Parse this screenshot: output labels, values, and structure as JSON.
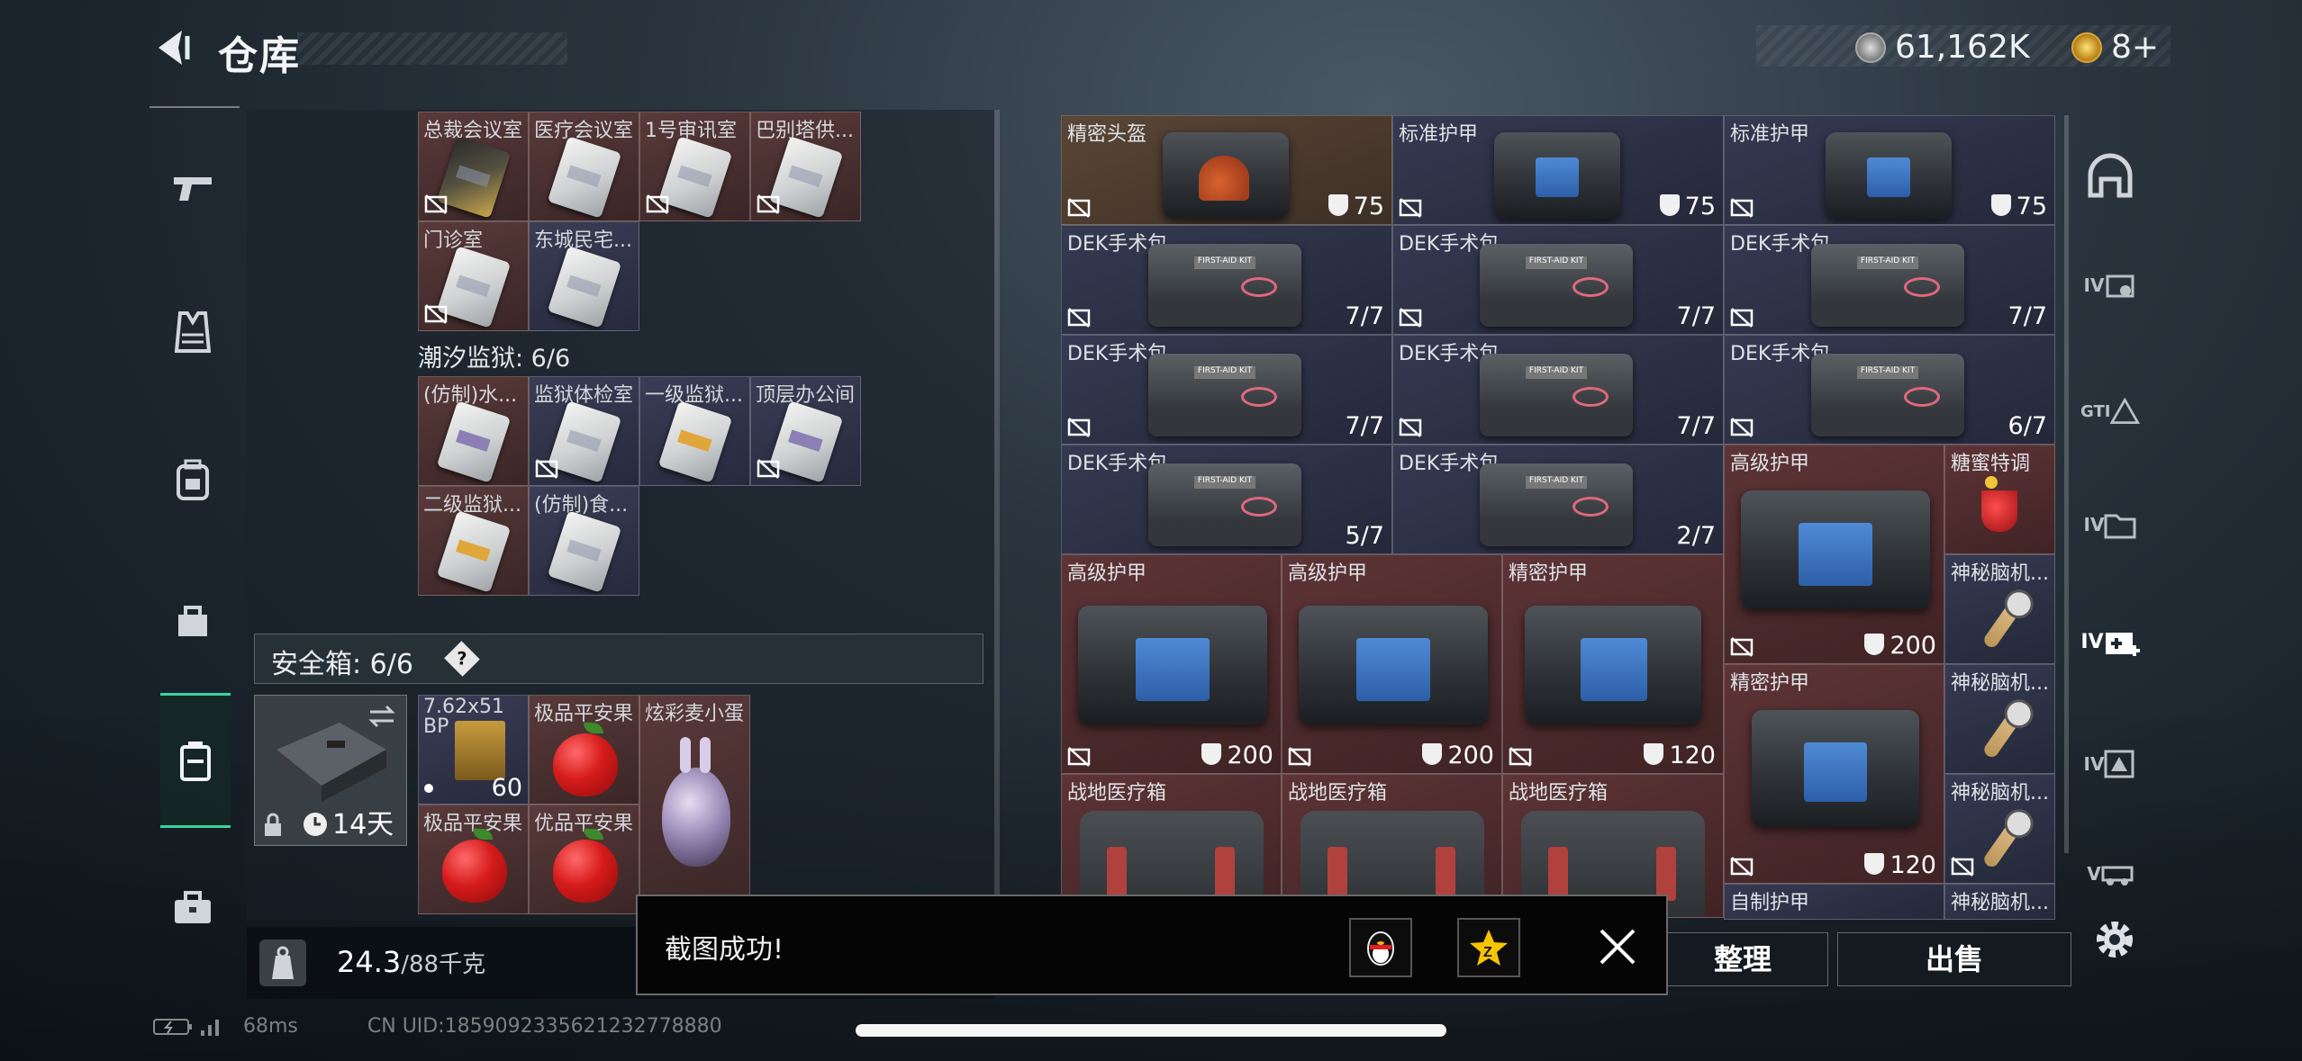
{
  "header": {
    "title": "仓库",
    "currency": [
      {
        "name": "silver-coin-icon",
        "value": "61,162K"
      },
      {
        "name": "gold-coin-icon",
        "value": "8+"
      }
    ]
  },
  "left_sidebar": {
    "items": [
      {
        "name": "weapon-tab",
        "icon": "pistol-icon"
      },
      {
        "name": "armor-tab",
        "icon": "vest-icon"
      },
      {
        "name": "backpack-tab",
        "icon": "backpack-icon"
      },
      {
        "name": "chest-rig-tab",
        "icon": "bag-icon"
      },
      {
        "name": "safebox-tab",
        "icon": "container-icon",
        "active": true
      },
      {
        "name": "briefcase-tab",
        "icon": "briefcase-icon"
      }
    ]
  },
  "stash": {
    "row1": [
      "总裁会议室",
      "医疗会议室",
      "1号审讯室",
      "巴别塔供..."
    ],
    "row2": [
      "门诊室",
      "东城民宅..."
    ],
    "section_prison": "潮汐监狱: 6/6",
    "row3": [
      "(仿制)水...",
      "监狱体检室",
      "一级监狱...",
      "顶层办公间"
    ],
    "row4": [
      "二级监狱...",
      "(仿制)食..."
    ],
    "safe_box_label": "安全箱: 6/6",
    "safe_box_help": "?",
    "safe_box_duration": "14天",
    "safe_items": [
      {
        "label": "7.62x51 BP",
        "count": "60"
      },
      {
        "label": "极品平安果"
      },
      {
        "label": "炫彩麦小蛋"
      },
      {
        "label": "极品平安果"
      },
      {
        "label": "优品平安果"
      }
    ],
    "weight_current": "24.3",
    "weight_max": "/88千克"
  },
  "inventory": {
    "row1": [
      {
        "label": "精密头盔",
        "value": "75"
      },
      {
        "label": "标准护甲",
        "value": "75"
      },
      {
        "label": "标准护甲",
        "value": "75"
      }
    ],
    "row2": [
      {
        "label": "DEK手术包",
        "value": "7/7"
      },
      {
        "label": "DEK手术包",
        "value": "7/7"
      },
      {
        "label": "DEK手术包",
        "value": "7/7"
      }
    ],
    "row3": [
      {
        "label": "DEK手术包",
        "value": "7/7"
      },
      {
        "label": "DEK手术包",
        "value": "7/7"
      },
      {
        "label": "DEK手术包",
        "value": "6/7"
      }
    ],
    "row4": [
      {
        "label": "DEK手术包",
        "value": "5/7"
      },
      {
        "label": "DEK手术包",
        "value": "2/7"
      }
    ],
    "big_armor_1": {
      "label": "高级护甲",
      "value": "200"
    },
    "drink": {
      "label": "糖蜜特调"
    },
    "row5": [
      {
        "label": "高级护甲",
        "value": "200"
      },
      {
        "label": "高级护甲",
        "value": "200"
      },
      {
        "label": "精密护甲",
        "value": "120"
      }
    ],
    "big_armor_2": {
      "label": "精密护甲",
      "value": "120"
    },
    "mystery": [
      "神秘脑机...",
      "神秘脑机...",
      "神秘脑机...",
      "神秘脑机..."
    ],
    "row6": [
      "战地医疗箱",
      "战地医疗箱",
      "战地医疗箱"
    ],
    "partial": "自制护甲",
    "bind_marker_text": ""
  },
  "right_sidebar": {
    "items": [
      "helmet-slot-icon",
      "IV",
      "GTI",
      "IV",
      "IV",
      "IV",
      "V"
    ]
  },
  "actions": {
    "sort": "整理",
    "sell": "出售"
  },
  "toast": {
    "message": "截图成功!"
  },
  "status": {
    "ping": "68ms",
    "uid": "CN UID:1859092335621232778880"
  }
}
